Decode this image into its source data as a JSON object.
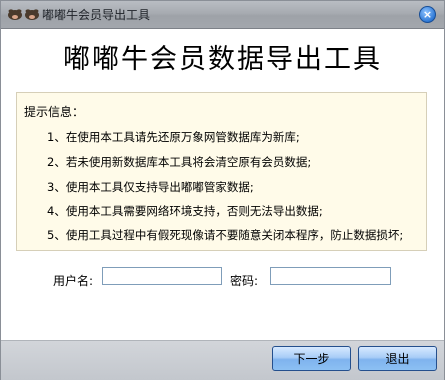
{
  "window": {
    "title": "嘟嘟牛会员导出工具",
    "close_glyph": "×"
  },
  "main": {
    "title": "嘟嘟牛会员数据导出工具"
  },
  "info": {
    "heading": "提示信息：",
    "items": [
      "1、在使用本工具请先还原万象网管数据库为新库;",
      "2、若未使用新数据库本工具将会清空原有会员数据;",
      "3、使用本工具仅支持导出嘟嘟管家数据;",
      "4、使用本工具需要网络环境支持，否则无法导出数据;",
      "5、使用工具过程中有假死现像请不要随意关闭本程序，防止数据损坏;"
    ]
  },
  "form": {
    "username_label": "用户名:",
    "username_value": "",
    "password_label": "密码:",
    "password_value": ""
  },
  "buttons": {
    "next": "下一步",
    "exit": "退出"
  },
  "colors": {
    "info_background": "#fffbe9",
    "button_accent": "#8cc0f3"
  },
  "icons": {
    "app": "cow-logo-icon",
    "close": "close-icon"
  }
}
